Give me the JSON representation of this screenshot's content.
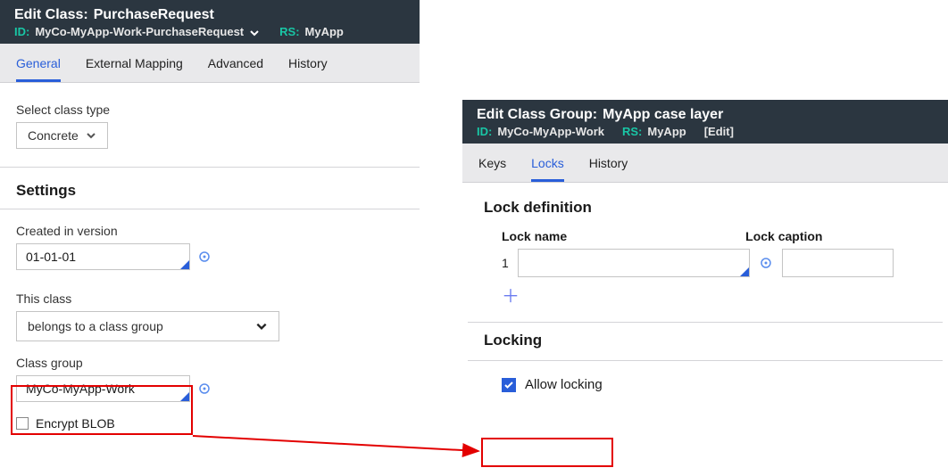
{
  "left": {
    "title_type": "Edit  Class:",
    "title_name": "PurchaseRequest",
    "id_k": "ID:",
    "id_v": "MyCo-MyApp-Work-PurchaseRequest",
    "rs_k": "RS:",
    "rs_v": "MyApp",
    "tabs": [
      "General",
      "External Mapping",
      "Advanced",
      "History"
    ],
    "active_tab": 0,
    "class_type_label": "Select class type",
    "class_type_value": "Concrete",
    "settings_title": "Settings",
    "created_label": "Created in version",
    "created_value": "01-01-01",
    "this_class_label": "This class",
    "this_class_value": "belongs to a class group",
    "class_group_label": "Class group",
    "class_group_value": "MyCo-MyApp-Work",
    "encrypt_label": "Encrypt BLOB"
  },
  "right": {
    "title_type": "Edit  Class Group:",
    "title_name": "MyApp case layer",
    "id_k": "ID:",
    "id_v": "MyCo-MyApp-Work",
    "rs_k": "RS:",
    "rs_v": "MyApp",
    "edit_label": "[Edit]",
    "tabs": [
      "Keys",
      "Locks",
      "History"
    ],
    "active_tab": 1,
    "lockdef_title": "Lock definition",
    "col_lockname": "Lock name",
    "col_lockcaption": "Lock caption",
    "row1_num": "1",
    "locking_title": "Locking",
    "allow_label": "Allow locking"
  }
}
